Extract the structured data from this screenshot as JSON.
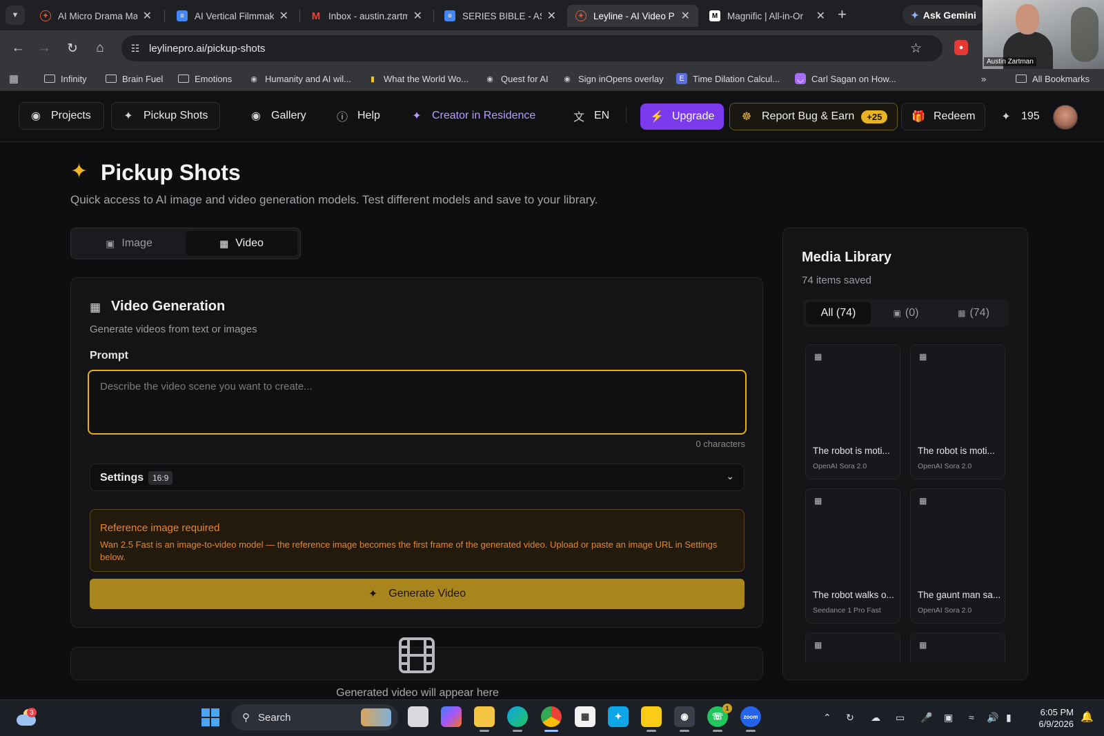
{
  "browser": {
    "tabs": [
      {
        "title": "AI Micro Drama Ma",
        "icon": "leyline-favicon",
        "color": "#e05a3c"
      },
      {
        "title": "AI Vertical Filmmak",
        "icon": "docs-favicon",
        "color": "#4285f4"
      },
      {
        "title": "Inbox - austin.zartm",
        "icon": "gmail-favicon",
        "color": "#ea4335"
      },
      {
        "title": "SERIES BIBLE - ASH",
        "icon": "docs-favicon",
        "color": "#4285f4"
      },
      {
        "title": "Leyline - AI Video P",
        "icon": "leyline-favicon",
        "color": "#e05a3c"
      },
      {
        "title": "Magnific | All-in-Or",
        "icon": "magnific-favicon",
        "color": "#ffffff"
      }
    ],
    "ask_gemini": "Ask Gemini",
    "url": "leylinepro.ai/pickup-shots",
    "bookmarks": [
      {
        "label": "Infinity",
        "icon": "folder-icon"
      },
      {
        "label": "Brain Fuel",
        "icon": "folder-icon"
      },
      {
        "label": "Emotions",
        "icon": "folder-icon"
      },
      {
        "label": "Humanity and AI wil...",
        "icon": "globe-icon"
      },
      {
        "label": "What the World Wo...",
        "icon": "bookmark-icon"
      },
      {
        "label": "Quest for AI",
        "icon": "globe-icon"
      },
      {
        "label": "Sign inOpens overlay",
        "icon": "globe-icon"
      },
      {
        "label": "Time Dilation Calcul...",
        "icon": "e-icon"
      },
      {
        "label": "Carl Sagan on How...",
        "icon": "pocket-icon"
      }
    ],
    "all_bookmarks": "All Bookmarks",
    "webcam_caption": "Austin Zartman"
  },
  "header": {
    "projects": "Projects",
    "pickup_shots": "Pickup Shots",
    "gallery": "Gallery",
    "help": "Help",
    "creator": "Creator in Residence",
    "language": "EN",
    "upgrade": "Upgrade",
    "report": "Report Bug & Earn",
    "report_badge": "+25",
    "redeem": "Redeem",
    "credits": "195"
  },
  "page": {
    "title": "Pickup Shots",
    "subtitle": "Quick access to AI image and video generation models. Test different models and save to your library.",
    "mode_image": "Image",
    "mode_video": "Video"
  },
  "generation": {
    "title": "Video Generation",
    "subtitle": "Generate videos from text or images",
    "prompt_label": "Prompt",
    "prompt_value": "",
    "prompt_placeholder": "Describe the video scene you want to create...",
    "char_count": "0 characters",
    "settings_label": "Settings",
    "aspect_ratio": "16:9",
    "warning_title": "Reference image required",
    "warning_body": "Wan 2.5 Fast is an image-to-video model — the reference image becomes the first frame of the generated video. Upload or paste an image URL in Settings below.",
    "generate_button": "Generate Video",
    "output_placeholder": "Generated video will appear here",
    "accent_color": "#e2b21f",
    "warning_color": "#e8862a"
  },
  "library": {
    "title": "Media Library",
    "count": "74 items saved",
    "tabs": [
      "All (74)",
      "(0)",
      "(74)"
    ],
    "items": [
      {
        "title": "The robot is moti...",
        "model": "OpenAI Sora 2.0"
      },
      {
        "title": "The robot is moti...",
        "model": "OpenAI Sora 2.0"
      },
      {
        "title": "The robot walks o...",
        "model": "Seedance 1 Pro Fast"
      },
      {
        "title": "The gaunt man sa...",
        "model": "OpenAI Sora 2.0"
      },
      {
        "title": "",
        "model": ""
      },
      {
        "title": "",
        "model": ""
      }
    ]
  },
  "taskbar": {
    "search": "Search",
    "weather_badge": "3",
    "whatsapp_badge": "1",
    "time": "6:05 PM",
    "date": "6/9/2026"
  }
}
